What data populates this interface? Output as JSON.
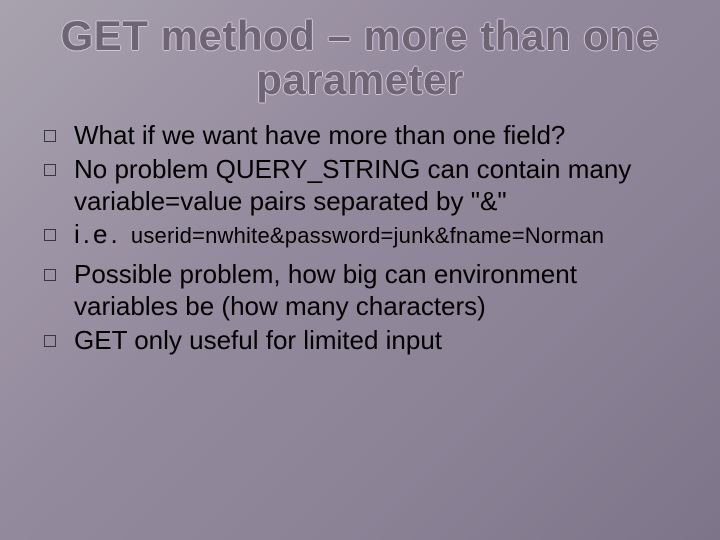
{
  "title_line1": "GET method – more than one",
  "title_line2": "parameter",
  "bullets": {
    "b1": "What if we want have more than one field?",
    "b2": "No problem QUERY_STRING can contain many variable=value pairs separated by \"&\"",
    "b3_lead": " i.e. ",
    "b3_code": " userid=nwhite&password=junk&fname=Norman",
    "b4": "Possible problem, how big can environment variables be (how  many characters)",
    "b5": "GET only useful for limited input"
  }
}
